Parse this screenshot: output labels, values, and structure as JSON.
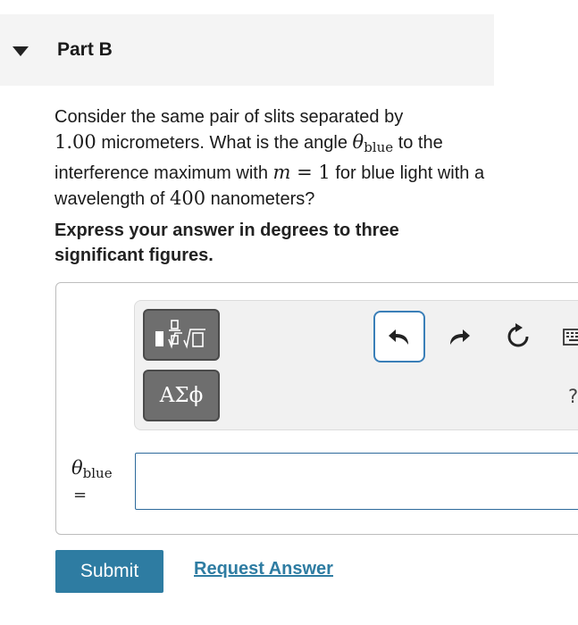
{
  "part": {
    "title": "Part B"
  },
  "question": {
    "t1": "Consider the same pair of slits separated by",
    "v_sep": "1.00",
    "t2": " micrometers. What is the angle ",
    "theta": "θ",
    "blue_sub": "blue",
    "t3": " to the interference maximum with ",
    "m": "m",
    "eq": " = ",
    "one": "1",
    "t4": " for blue light with a wavelength of ",
    "v_wl": "400",
    "t5": " nanometers?"
  },
  "instructions": "Express your answer in degrees to three significant figures.",
  "toolbar": {
    "templates_icon": "fraction-radical-template-icon",
    "greek_label": "ΑΣϕ",
    "undo_icon": "undo-icon",
    "redo_icon": "redo-icon",
    "reset_icon": "reset-icon",
    "keyboard_icon": "keyboard-icon",
    "help_label": "?"
  },
  "answer": {
    "var_theta": "θ",
    "var_sub": "blue",
    "equals": "=",
    "value": "",
    "placeholder": ""
  },
  "actions": {
    "submit_label": "Submit",
    "request_label": "Request Answer"
  },
  "colors": {
    "accent": "#2e7ca2",
    "header_bg": "#f4f4f4",
    "toolbar_bg": "#f1f1f1",
    "tool_button": "#6e6e6e"
  }
}
